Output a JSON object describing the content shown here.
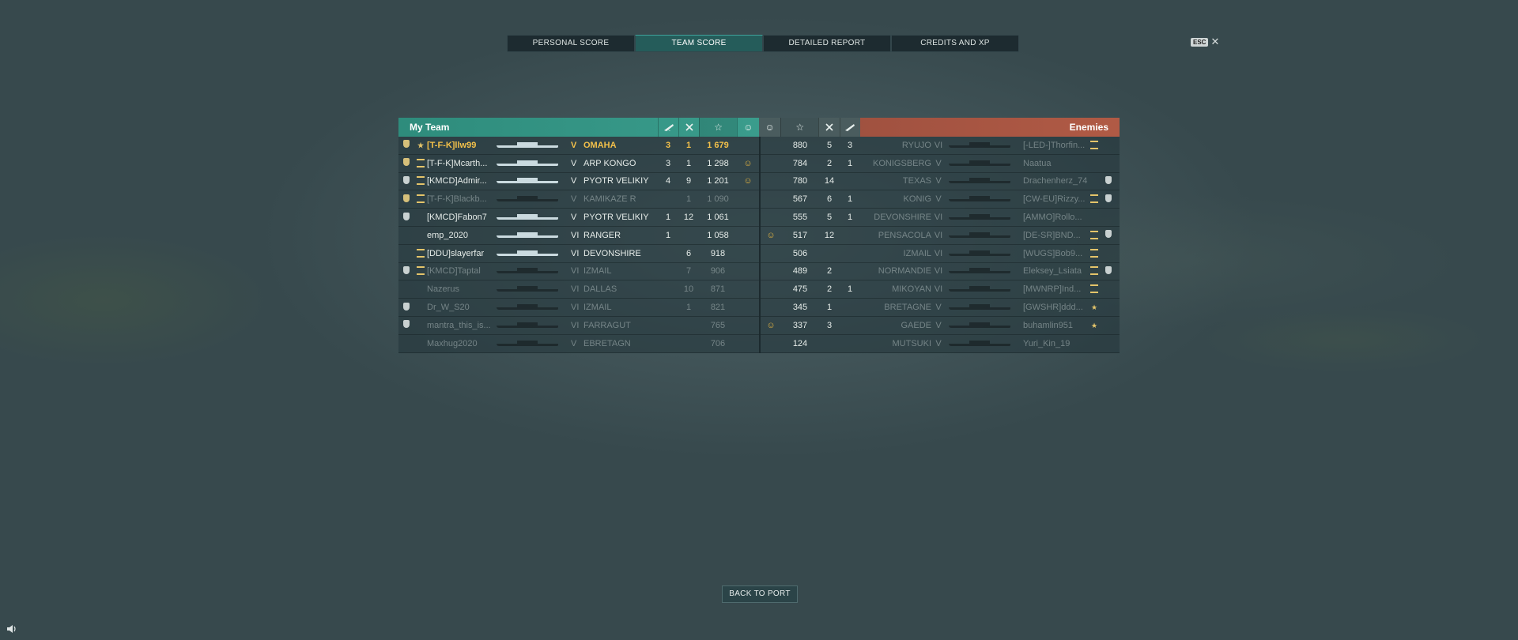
{
  "tabs": [
    {
      "label": "PERSONAL SCORE",
      "active": false
    },
    {
      "label": "TEAM SCORE",
      "active": true
    },
    {
      "label": "DETAILED REPORT",
      "active": false
    },
    {
      "label": "CREDITS AND XP",
      "active": false
    }
  ],
  "esc": {
    "key": "ESC",
    "close": "✕"
  },
  "my_team": {
    "title": "My Team",
    "header_icons": [
      "plane-icon",
      "kills-icon",
      "star-icon",
      "smile-icon"
    ],
    "rows": [
      {
        "badge": "gold",
        "rank": "★",
        "rank_num": "10",
        "name": "[T-F-K]llw99",
        "ship": "OMAHA",
        "tier": "V",
        "planes": "3",
        "kills": "1",
        "score": "1 679",
        "karma": "",
        "status": "highlight"
      },
      {
        "badge": "gold",
        "rank": "bar",
        "rank_num": "12",
        "name": "[T-F-K]Mcarth...",
        "ship": "ARP KONGŌ",
        "tier": "V",
        "planes": "3",
        "kills": "1",
        "score": "1 298",
        "karma": "☺",
        "status": "alive"
      },
      {
        "badge": "silver",
        "rank": "bars",
        "rank_num": "16",
        "name": "[KMCD]Admir...",
        "ship": "PYOTR VELIKIY",
        "tier": "V",
        "planes": "4",
        "kills": "9",
        "score": "1 201",
        "karma": "☺",
        "status": "alive"
      },
      {
        "badge": "gold",
        "rank": "bars",
        "rank_num": "",
        "name": "[T-F-K]Blackb...",
        "ship": "KAMIKAZE R",
        "tier": "V",
        "planes": "",
        "kills": "1",
        "score": "1 090",
        "karma": "",
        "status": "dead"
      },
      {
        "badge": "silver",
        "rank": "",
        "rank_num": "",
        "name": "[KMCD]Fabon7",
        "ship": "PYOTR VELIKIY",
        "tier": "V",
        "planes": "1",
        "kills": "12",
        "score": "1 061",
        "karma": "",
        "status": "alive"
      },
      {
        "badge": "",
        "rank": "",
        "rank_num": "",
        "name": "emp_2020",
        "ship": "RANGER",
        "tier": "VI",
        "planes": "1",
        "kills": "",
        "score": "1 058",
        "karma": "",
        "status": "alive"
      },
      {
        "badge": "",
        "rank": "bar",
        "rank_num": "12",
        "name": "[DDU]slayerfar",
        "ship": "DEVONSHIRE",
        "tier": "VI",
        "planes": "",
        "kills": "6",
        "score": "918",
        "karma": "",
        "status": "alive"
      },
      {
        "badge": "silver",
        "rank": "bars",
        "rank_num": "16",
        "name": "[KMCD]Taptal",
        "ship": "IZMAIL",
        "tier": "VI",
        "planes": "",
        "kills": "7",
        "score": "906",
        "karma": "",
        "status": "dead"
      },
      {
        "badge": "",
        "rank": "",
        "rank_num": "",
        "name": "Nazerus",
        "ship": "DALLAS",
        "tier": "VI",
        "planes": "",
        "kills": "10",
        "score": "871",
        "karma": "",
        "status": "dead"
      },
      {
        "badge": "silver",
        "rank": "",
        "rank_num": "",
        "name": "Dr_W_S20",
        "ship": "IZMAIL",
        "tier": "VI",
        "planes": "",
        "kills": "1",
        "score": "821",
        "karma": "",
        "status": "dead"
      },
      {
        "badge": "silver",
        "rank": "",
        "rank_num": "",
        "name": "mantra_this_is...",
        "ship": "FARRAGUT",
        "tier": "VI",
        "planes": "",
        "kills": "",
        "score": "765",
        "karma": "",
        "status": "dead"
      },
      {
        "badge": "",
        "rank": "",
        "rank_num": "",
        "name": "Maxhug2020",
        "ship": "EBRETAGN",
        "tier": "V",
        "planes": "",
        "kills": "",
        "score": "706",
        "karma": "",
        "status": "dead"
      }
    ]
  },
  "enemies": {
    "title": "Enemies",
    "rows": [
      {
        "karma": "",
        "score": "880",
        "kills": "5",
        "planes": "3",
        "ship": "RYUJO",
        "tier": "VI",
        "name": "[-LED-]Thorfin...",
        "rank": "bar",
        "rank_num": "15",
        "badge": "",
        "status": "dead"
      },
      {
        "karma": "",
        "score": "784",
        "kills": "2",
        "planes": "1",
        "ship": "KONIGSBERG",
        "tier": "V",
        "name": "Naatua",
        "rank": "",
        "rank_num": "",
        "badge": "",
        "status": "dead"
      },
      {
        "karma": "",
        "score": "780",
        "kills": "14",
        "planes": "",
        "ship": "TEXAS",
        "tier": "V",
        "name": "Drachenherz_74",
        "rank": "",
        "rank_num": "",
        "badge": "silver",
        "status": "dead"
      },
      {
        "karma": "",
        "score": "567",
        "kills": "6",
        "planes": "1",
        "ship": "KONIG",
        "tier": "V",
        "name": "[CW-EU]Rizzy...",
        "rank": "bars",
        "rank_num": "",
        "badge": "silver",
        "status": "dead"
      },
      {
        "karma": "",
        "score": "555",
        "kills": "5",
        "planes": "1",
        "ship": "DEVONSHIRE",
        "tier": "VI",
        "name": "[AMMO]Rollo...",
        "rank": "",
        "rank_num": "",
        "badge": "",
        "status": "dead"
      },
      {
        "karma": "☺",
        "score": "517",
        "kills": "12",
        "planes": "",
        "ship": "PENSACOLA",
        "tier": "VI",
        "name": "[DE-SR]BND...",
        "rank": "bars",
        "rank_num": "",
        "badge": "silver",
        "status": "dead"
      },
      {
        "karma": "",
        "score": "506",
        "kills": "",
        "planes": "",
        "ship": "IZMAIL",
        "tier": "VI",
        "name": "[WUGS]Bob9...",
        "rank": "bars",
        "rank_num": "",
        "badge": "",
        "status": "dead"
      },
      {
        "karma": "",
        "score": "489",
        "kills": "2",
        "planes": "",
        "ship": "NORMANDIE",
        "tier": "VI",
        "name": "Eleksey_Lsiata",
        "rank": "bars",
        "rank_num": "",
        "badge": "silver",
        "status": "dead"
      },
      {
        "karma": "",
        "score": "475",
        "kills": "2",
        "planes": "1",
        "ship": "MIKOYAN",
        "tier": "VI",
        "name": "[MWNRP]Ind...",
        "rank": "bars",
        "rank_num": "",
        "badge": "",
        "status": "dead"
      },
      {
        "karma": "",
        "score": "345",
        "kills": "1",
        "planes": "",
        "ship": "BRETAGNE",
        "tier": "V",
        "name": "[GWSHR]ddd...",
        "rank": "★",
        "rank_num": "10",
        "badge": "",
        "status": "dead"
      },
      {
        "karma": "☺",
        "score": "337",
        "kills": "3",
        "planes": "",
        "ship": "GAEDE",
        "tier": "V",
        "name": "buhamlin951",
        "rank": "★",
        "rank_num": "10",
        "badge": "",
        "status": "dead"
      },
      {
        "karma": "",
        "score": "124",
        "kills": "",
        "planes": "",
        "ship": "MUTSUKI",
        "tier": "V",
        "name": "Yuri_Kin_19",
        "rank": "",
        "rank_num": "",
        "badge": "",
        "status": "dead"
      }
    ]
  },
  "back_button": "BACK TO PORT",
  "sound_icon": "speaker-icon"
}
